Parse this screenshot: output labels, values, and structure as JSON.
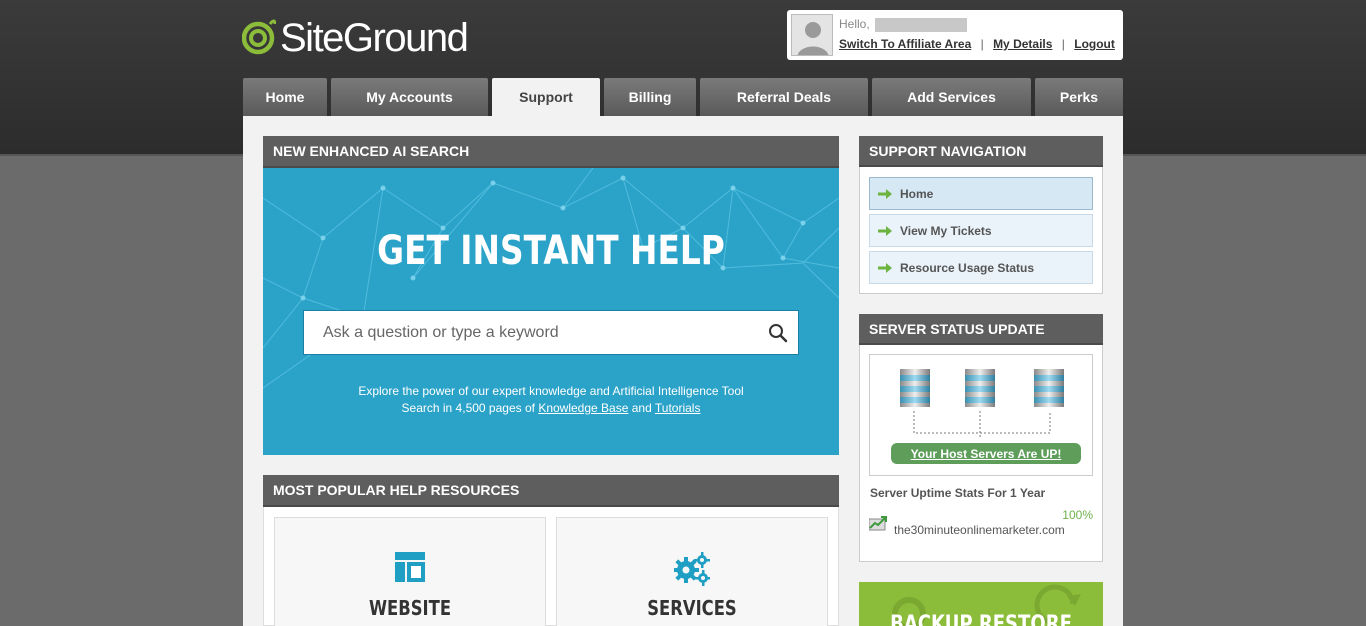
{
  "brand": {
    "name": "SiteGround",
    "accent": "#8cbd3a"
  },
  "user": {
    "greeting": "Hello,",
    "links": {
      "affiliate": "Switch To Affiliate Area",
      "details": "My Details",
      "logout": "Logout"
    },
    "separator": "|"
  },
  "nav": {
    "tabs": [
      {
        "label": "Home"
      },
      {
        "label": "My Accounts"
      },
      {
        "label": "Support"
      },
      {
        "label": "Billing"
      },
      {
        "label": "Referral Deals"
      },
      {
        "label": "Add Services"
      },
      {
        "label": "Perks"
      }
    ],
    "active": "Support"
  },
  "search_panel": {
    "heading": "NEW ENHANCED AI SEARCH",
    "title": "GET INSTANT HELP",
    "placeholder": "Ask a question or type a keyword",
    "desc_line1": "Explore the power of our expert knowledge and Artificial Intelligence Tool",
    "desc_prefix": "Search in 4,500 pages of",
    "kb_link": "Knowledge Base",
    "and": "and",
    "tutorials_link": "Tutorials",
    "bg_color": "#2ba3c9"
  },
  "resources": {
    "heading": "MOST POPULAR HELP RESOURCES",
    "cards": [
      {
        "label": "WEBSITE",
        "icon": "layout-icon"
      },
      {
        "label": "SERVICES",
        "icon": "gears-icon"
      }
    ]
  },
  "support_nav": {
    "heading": "SUPPORT NAVIGATION",
    "items": [
      {
        "label": "Home"
      },
      {
        "label": "View My Tickets"
      },
      {
        "label": "Resource Usage Status"
      }
    ]
  },
  "server_status": {
    "heading": "SERVER STATUS UPDATE",
    "status_link": "Your Host Servers Are UP!",
    "uptime_title": "Server Uptime Stats For 1 Year",
    "uptime_pct": "100%",
    "domain": "the30minuteonlinemarketer.com"
  },
  "backup": {
    "title": "BACKUP RESTORE"
  }
}
